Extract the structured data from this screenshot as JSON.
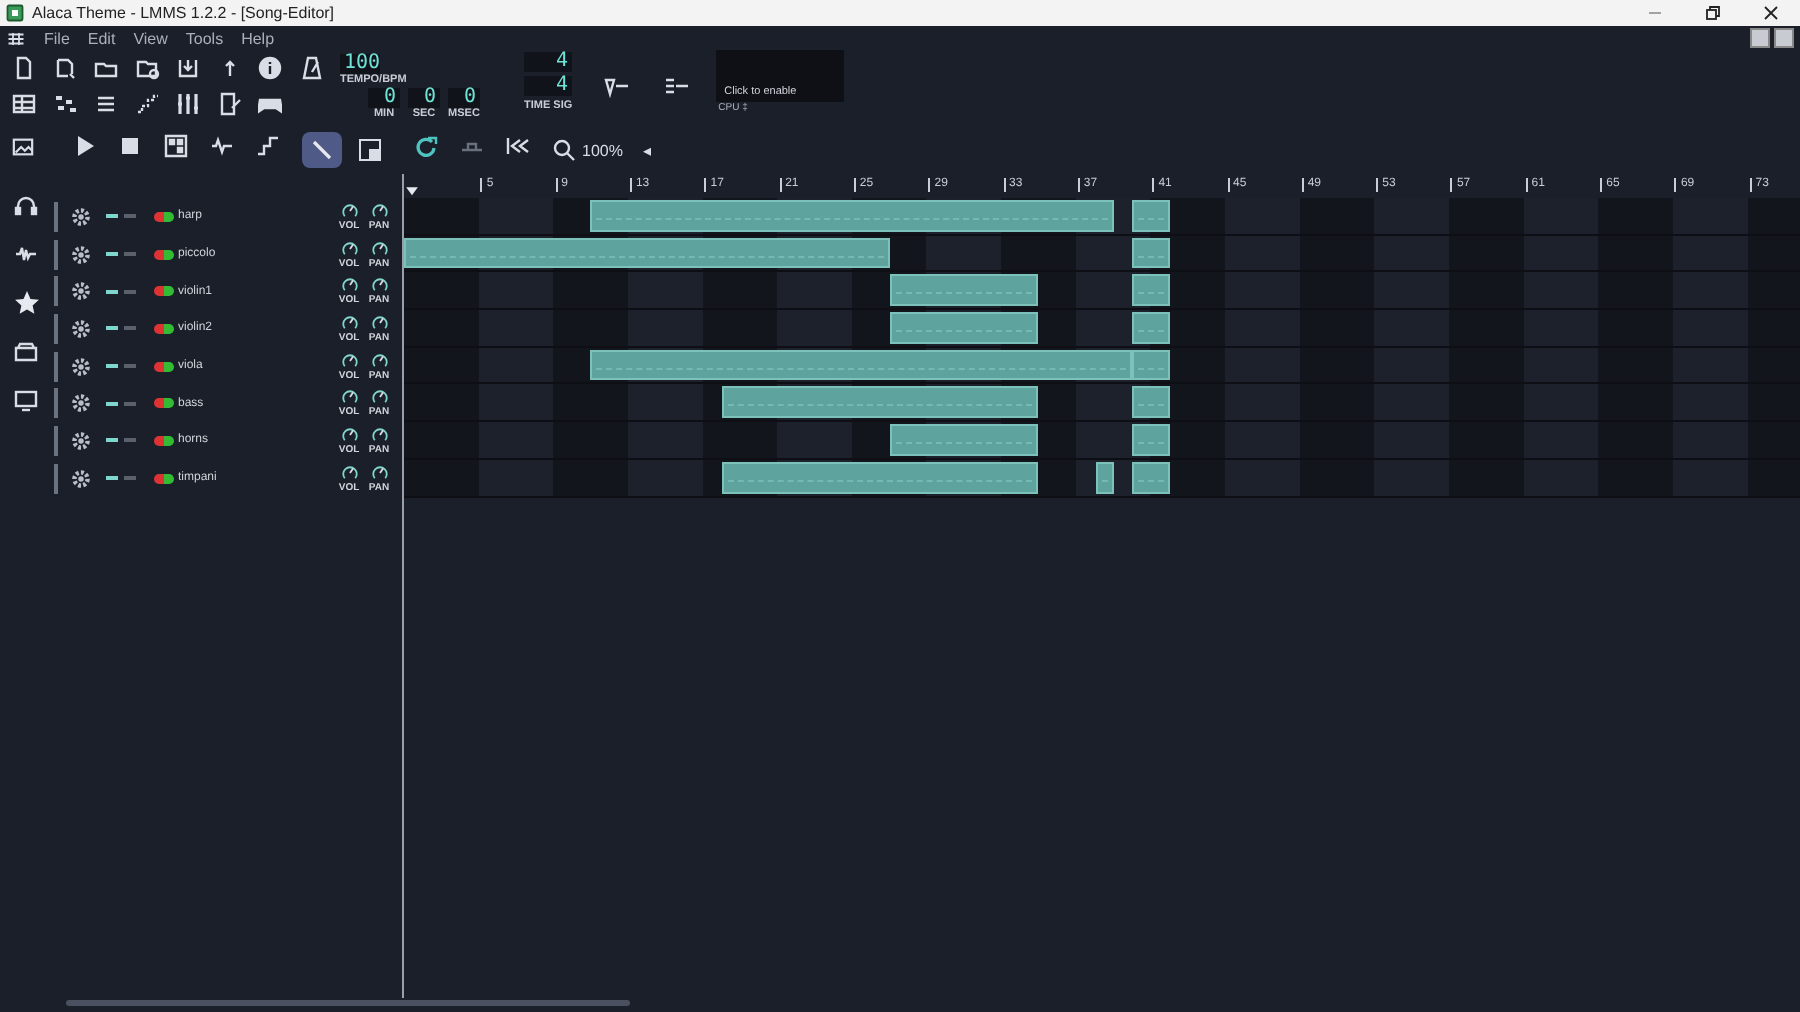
{
  "window": {
    "title": "Alaca Theme - LMMS 1.2.2 - [Song-Editor]"
  },
  "menu": [
    "File",
    "Edit",
    "View",
    "Tools",
    "Help"
  ],
  "tempo": {
    "value": "100",
    "label": "TEMPO/BPM"
  },
  "time": [
    {
      "value": "0",
      "label": "MIN"
    },
    {
      "value": "0",
      "label": "SEC"
    },
    {
      "value": "0",
      "label": "MSEC"
    }
  ],
  "time_signature": {
    "numerator": "4",
    "denominator": "4",
    "label": "TIME SIG"
  },
  "cpu": {
    "hint": "Click to enable",
    "label": "CPU ‡"
  },
  "edit_modes": [
    {
      "kind": "draw",
      "selected": true
    },
    {
      "kind": "select",
      "selected": false
    }
  ],
  "zoom": {
    "value": "100%",
    "arrow": "◂"
  },
  "timeline": {
    "ticks": [
      "5",
      "9",
      "13",
      "17",
      "21",
      "25",
      "29",
      "33",
      "37",
      "41",
      "45",
      "49",
      "53",
      "57",
      "61",
      "65",
      "69",
      "73"
    ]
  },
  "tracks": [
    {
      "name": "harp",
      "on": true,
      "knobs": [
        "VOL",
        "PAN"
      ]
    },
    {
      "name": "piccolo",
      "on": true,
      "knobs": [
        "VOL",
        "PAN"
      ]
    },
    {
      "name": "violin1",
      "on": true,
      "knobs": [
        "VOL",
        "PAN"
      ]
    },
    {
      "name": "violin2",
      "on": true,
      "knobs": [
        "VOL",
        "PAN"
      ]
    },
    {
      "name": "viola",
      "on": true,
      "knobs": [
        "VOL",
        "PAN"
      ]
    },
    {
      "name": "bass",
      "on": true,
      "knobs": [
        "VOL",
        "PAN"
      ]
    },
    {
      "name": "horns",
      "on": true,
      "knobs": [
        "VOL",
        "PAN"
      ]
    },
    {
      "name": "timpani",
      "on": true,
      "knobs": [
        "VOL",
        "PAN"
      ]
    }
  ]
}
